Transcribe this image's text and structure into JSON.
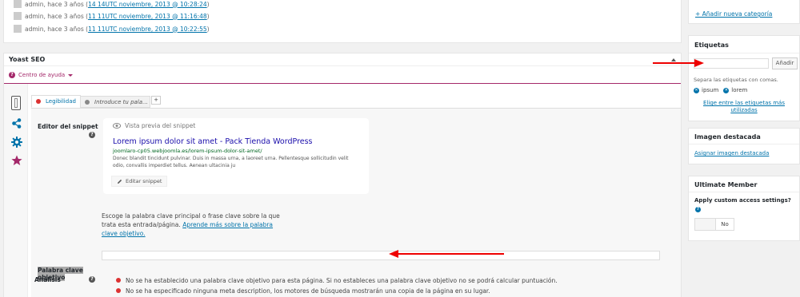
{
  "revisions": [
    {
      "author_text": "admin, hace 3 años (",
      "link": "14 14UTC noviembre, 2013 @ 10:28:24",
      "close": ")"
    },
    {
      "author_text": "admin, hace 3 años (",
      "link": "11 11UTC noviembre, 2013 @ 11:16:48",
      "close": ")"
    },
    {
      "author_text": "admin, hace 3 años (",
      "link": "11 11UTC noviembre, 2013 @ 10:22:55",
      "close": ")"
    }
  ],
  "yoast": {
    "title": "Yoast SEO",
    "help_center": "Centro de ayuda",
    "tabs": {
      "readability": "Legibilidad",
      "keyword_tab": "Introduce tu pala…",
      "add": "+"
    },
    "snippet": {
      "label": "Editor del snippet",
      "preview_label": "Vista previa del snippet",
      "title": "Lorem ipsum dolor sit amet - Pack Tienda WordPress",
      "url": "joomlaro-cp05.webjoomla.es/lorem-ipsum-dolor-sit-amet/",
      "description_line1": "Donec blandit tincidunt pulvinar. Duis in massa urna, a laoreet urna. Pellentesque sollicitudin velit",
      "description_line2": "odio, convallis imperdiet tellus. Aenean ultacinia ju",
      "edit_button": "Editar snippet"
    },
    "focus_keyword": {
      "label_line1": "Palabra clave",
      "label_line2": "objetivo",
      "desc_line1": "Escoge la palabra clave principal o frase clave sobre la que",
      "desc_line2_text": "trata esta entrada/página. ",
      "desc_link_part1": "Aprende más sobre la palabra",
      "desc_link_part2": "clave objetivo.",
      "input_value": ""
    },
    "analysis": {
      "label": "Análisis",
      "items": [
        "No se ha establecido una palabra clave objetivo para esta página. Si no estableces una palabra clave objetivo no se podrá calcular puntuación.",
        "No se ha especificado ninguna meta description, los motores de búsqueda mostrarán una copia de la página en su lugar."
      ]
    }
  },
  "sidebar": {
    "add_category": "+ Añadir nueva categoría",
    "tags": {
      "title": "Etiquetas",
      "input_value": "",
      "add_button": "Añadir",
      "hint": "Separa las etiquetas con comas.",
      "items": [
        "ipsum",
        "lorem"
      ],
      "choose_link_line1": "Elige entre las etiquetas más",
      "choose_link_line2": "utilizadas"
    },
    "featured_image": {
      "title": "Imagen destacada",
      "link": "Asignar imagen destacada"
    },
    "ultimate_member": {
      "title": "Ultimate Member",
      "question": "Apply custom access settings?",
      "help": "?",
      "toggle_value": "No"
    }
  },
  "colors": {
    "link": "#0073aa",
    "snippet_title": "#1a0dab",
    "snippet_url": "#006621",
    "error": "#dc3232",
    "yoast_accent": "#a4286a",
    "arrow": "#e00000"
  }
}
